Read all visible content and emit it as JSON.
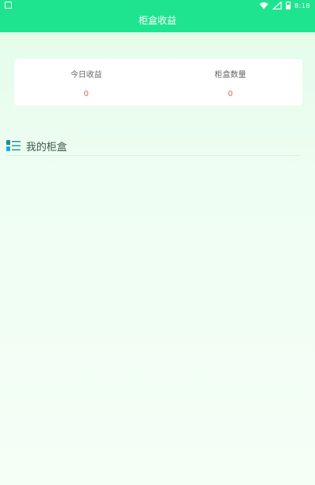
{
  "status_bar": {
    "time": "8:18",
    "icons": [
      "notification-icon",
      "wifi-icon",
      "signal-icon",
      "battery-icon"
    ]
  },
  "header": {
    "title": "柜盒收益",
    "background_color": "#1fe48f"
  },
  "stats": {
    "today_income_label": "今日收益",
    "today_income_value": "0",
    "box_count_label": "柜盒数量",
    "box_count_value": "0",
    "value_color": "#e06a5a"
  },
  "section": {
    "title": "我的柜盒",
    "icon": "list-icon"
  }
}
